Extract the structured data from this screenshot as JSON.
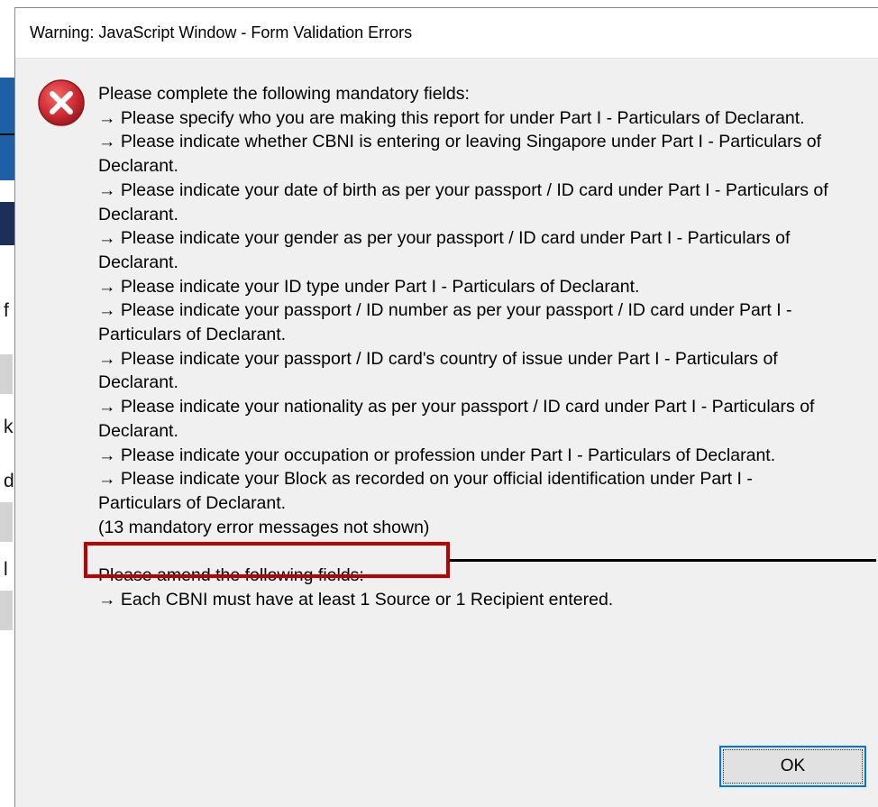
{
  "window": {
    "title": "Warning: JavaScript Window - Form Validation Errors"
  },
  "icon": {
    "name": "error-icon",
    "color": "#c8262d"
  },
  "mandatory": {
    "header": "Please complete the following mandatory fields:",
    "lines": [
      "→ Please specify who you are making this report for under Part I - Particulars of Declarant.",
      "→ Please indicate whether CBNI is entering or leaving Singapore under Part I - Particulars of",
      "Declarant.",
      "→ Please indicate your date of birth as per your passport / ID card under Part I - Particulars of",
      "Declarant.",
      "→ Please indicate your gender as per your passport / ID card under Part I - Particulars of",
      "Declarant.",
      "→ Please indicate your ID type under Part I - Particulars of Declarant.",
      "→ Please indicate your passport / ID number as per your passport / ID card under Part I -",
      "Particulars of Declarant.",
      "→ Please indicate your passport / ID card's country of issue under Part I - Particulars of",
      "Declarant.",
      "→ Please indicate your nationality as per your passport / ID card under Part I - Particulars of",
      "Declarant.",
      "→ Please indicate your occupation or profession under Part I - Particulars of Declarant.",
      "→ Please indicate your Block as recorded on your official identification under Part I -",
      "Particulars of Declarant."
    ],
    "hidden_note": "(13 mandatory error messages not shown)"
  },
  "amend": {
    "header": "Please amend the following fields:",
    "lines": [
      "→ Each CBNI must have at least 1 Source or 1 Recipient entered."
    ]
  },
  "buttons": {
    "ok_label": "OK"
  },
  "colors": {
    "highlight": "#c00000",
    "button_focus": "#0078d7",
    "dialog_bg": "#f0f0f0"
  },
  "background_fragments": [
    "f",
    "k",
    "d",
    "l"
  ]
}
